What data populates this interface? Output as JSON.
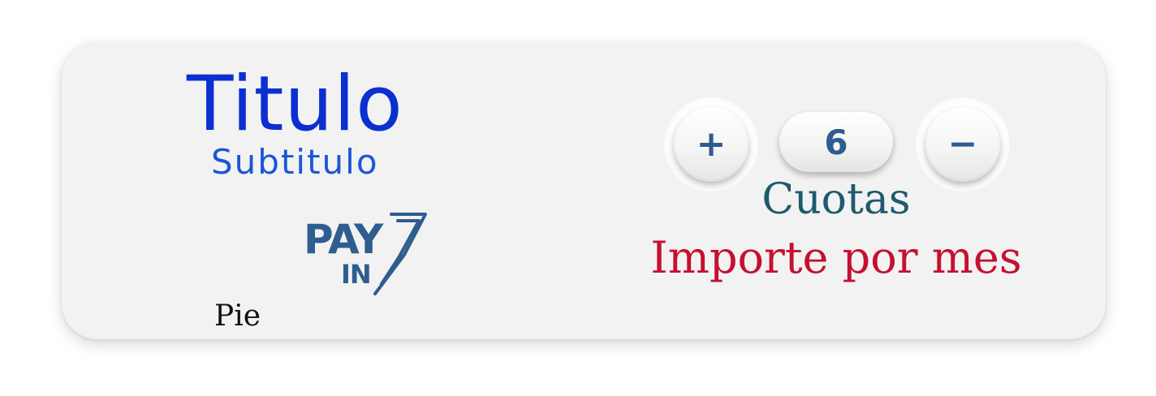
{
  "card": {
    "title": "Titulo",
    "subtitle": "Subtitulo",
    "logo": {
      "line1": "PAY",
      "line2": "IN",
      "mark": "7"
    },
    "footer": "Pie"
  },
  "installments": {
    "increase_label": "+",
    "decrease_label": "−",
    "count": "6",
    "count_label": "Cuotas",
    "monthly_amount_label": "Importe por mes"
  },
  "colors": {
    "title": "#0b2fd1",
    "subtitle": "#1a56d6",
    "brand": "#2e5d8f",
    "cuotas": "#1d5a6e",
    "importe": "#c5102f"
  },
  "icons": {
    "increase": "plus-icon",
    "decrease": "minus-icon"
  }
}
